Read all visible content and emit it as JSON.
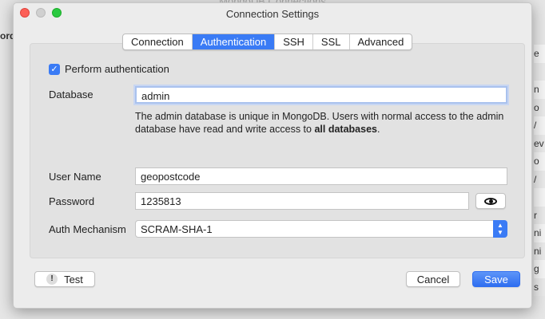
{
  "background": {
    "title": "MongoDB Connections",
    "left_fragment": "ord",
    "right_fragments": [
      "e",
      "",
      "n",
      "o",
      "/",
      "ev",
      "o",
      "/",
      "",
      "r",
      "ni",
      "ni",
      "g",
      "s"
    ]
  },
  "window": {
    "title": "Connection Settings"
  },
  "tabs": [
    {
      "label": "Connection"
    },
    {
      "label": "Authentication",
      "active": true
    },
    {
      "label": "SSH"
    },
    {
      "label": "SSL"
    },
    {
      "label": "Advanced"
    }
  ],
  "auth": {
    "perform_label": "Perform authentication",
    "perform_checked": true,
    "database_label": "Database",
    "database_value": "admin",
    "help_text": "The admin database is unique in MongoDB. Users with normal access to the admin database have read and write access to ",
    "help_bold": "all databases",
    "help_end": ".",
    "username_label": "User Name",
    "username_value": "geopostcode",
    "password_label": "Password",
    "password_value": "1235813",
    "mechanism_label": "Auth Mechanism",
    "mechanism_value": "SCRAM-SHA-1"
  },
  "buttons": {
    "test": "Test",
    "test_icon": "!",
    "cancel": "Cancel",
    "save": "Save"
  },
  "colors": {
    "accent": "#3a7bf5"
  }
}
